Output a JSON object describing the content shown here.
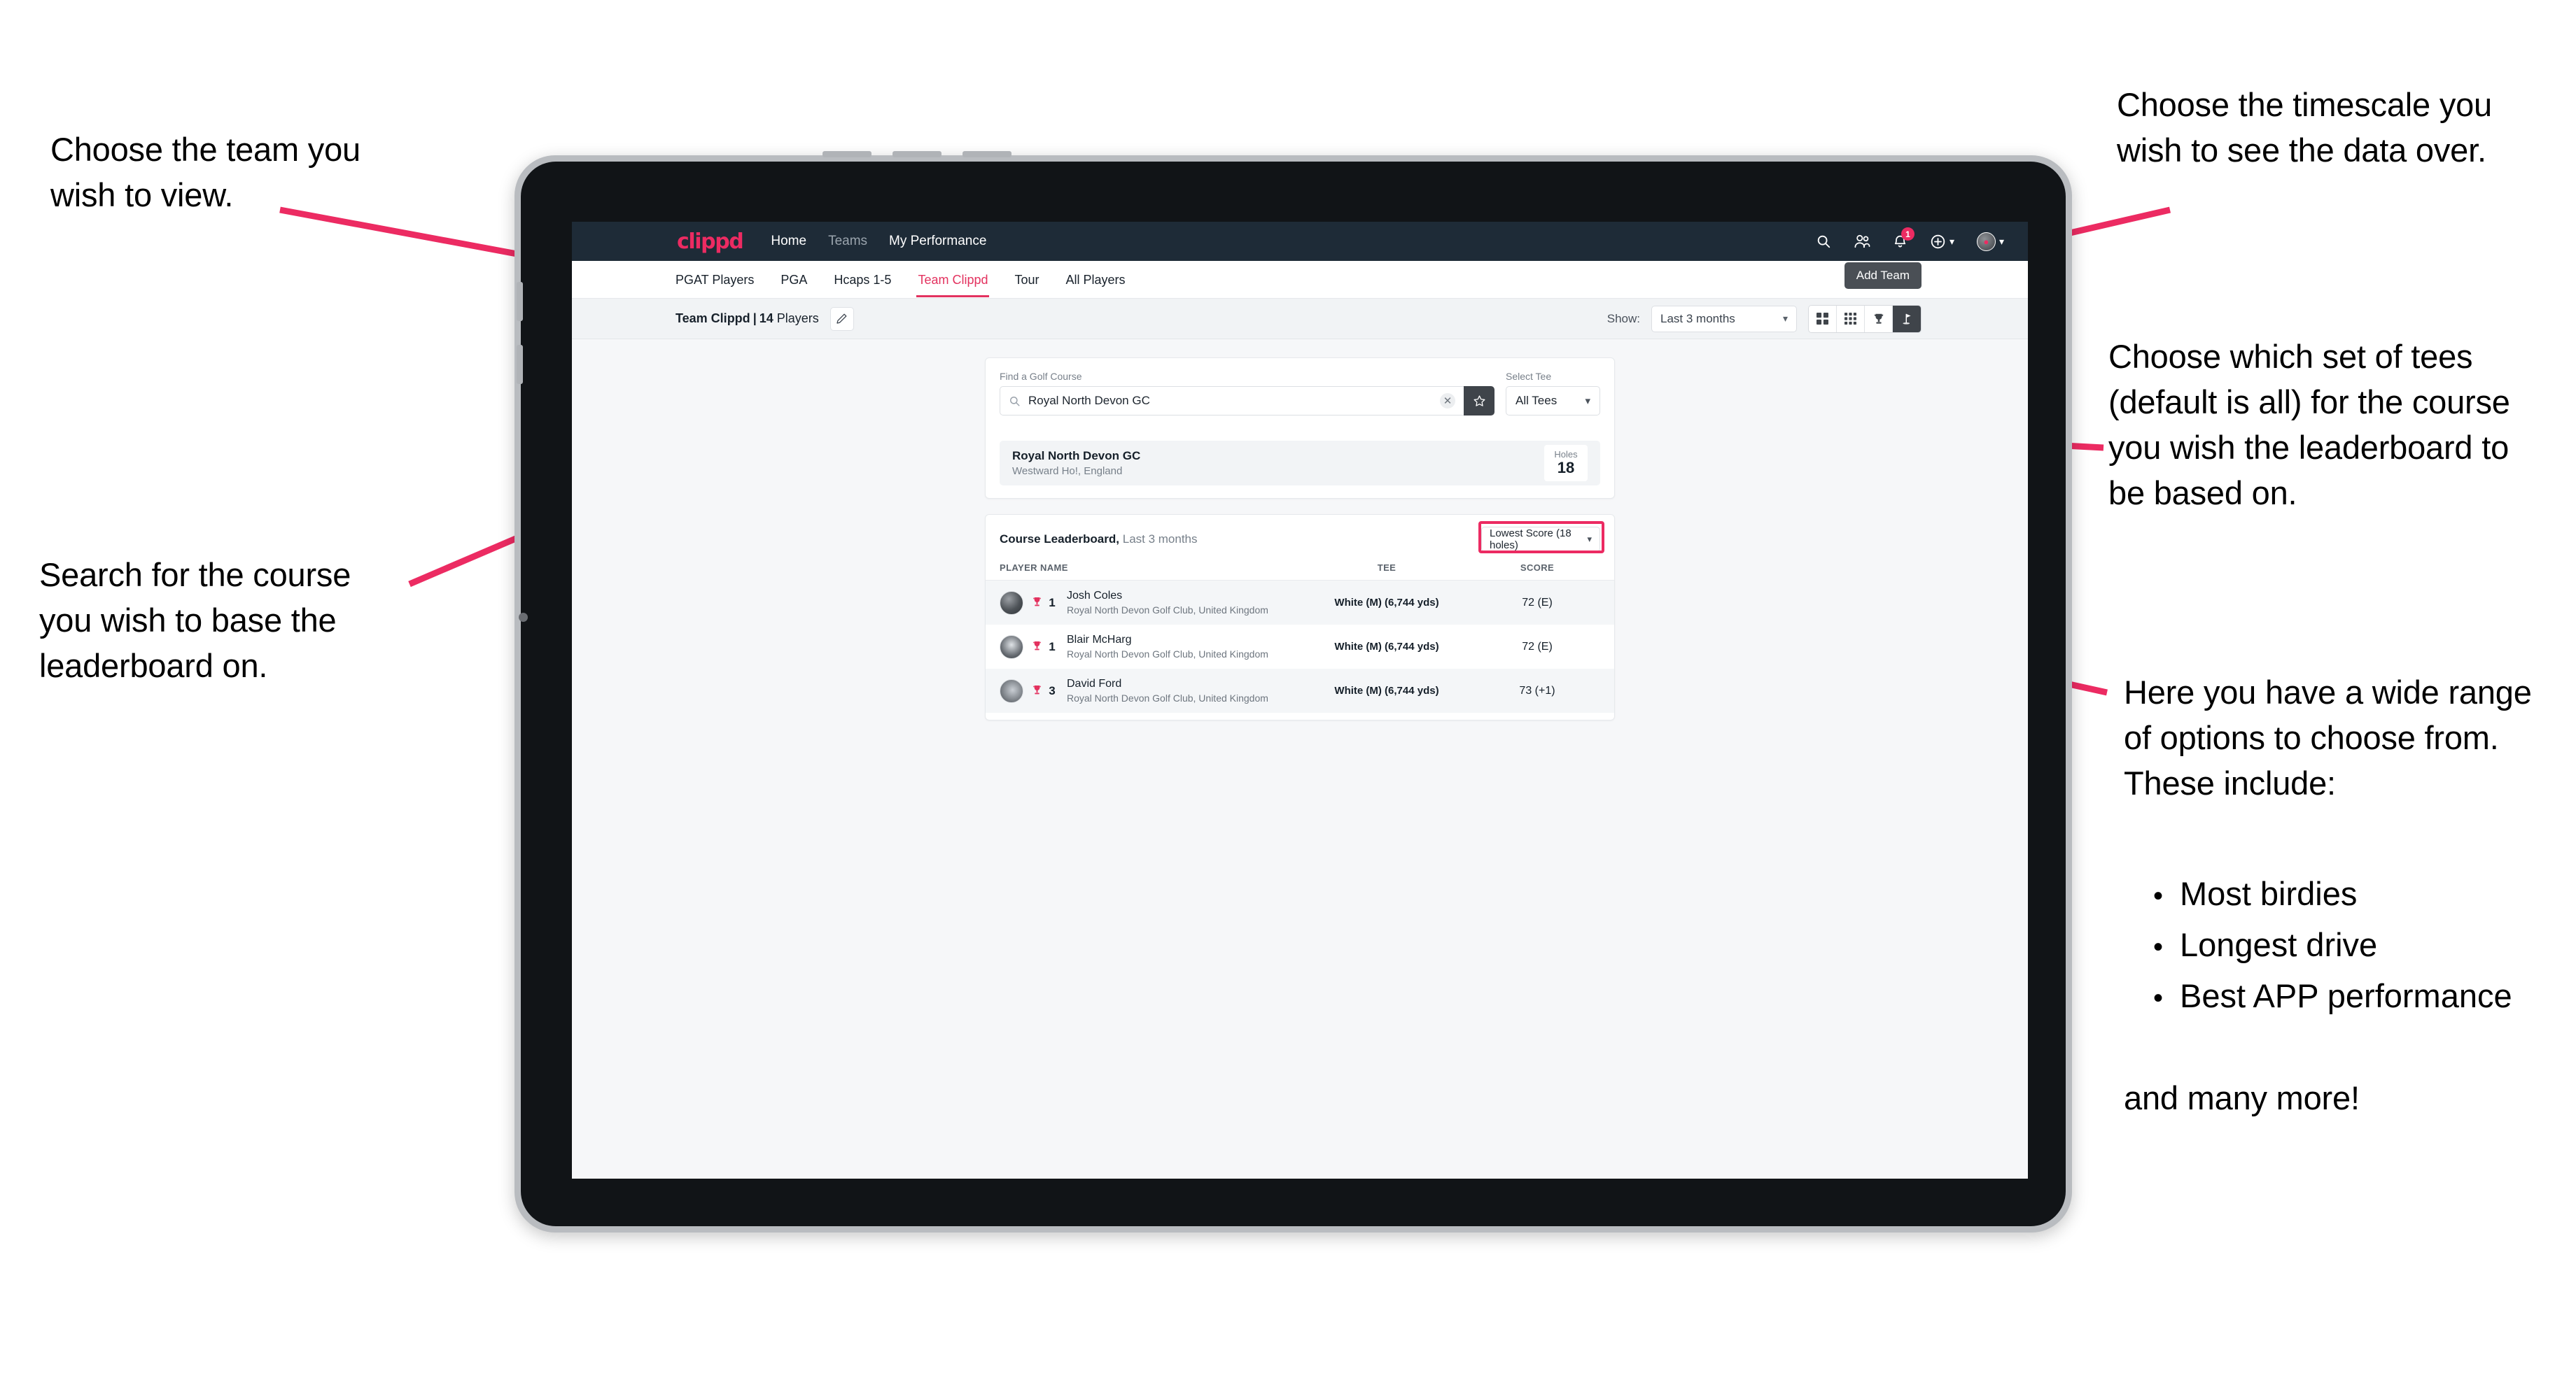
{
  "annotations": {
    "team": "Choose the team you\nwish to view.",
    "course_search": "Search for the course\nyou wish to base the\nleaderboard on.",
    "timescale": "Choose the timescale you\nwish to see the data over.",
    "tees": "Choose which set of tees\n(default is all) for the course\nyou wish the leaderboard to\nbe based on.",
    "options_intro": "Here you have a wide range\nof options to choose from.\nThese include:",
    "options_list": [
      "Most birdies",
      "Longest drive",
      "Best APP performance"
    ],
    "options_outro": "and many more!"
  },
  "app": {
    "brand": "clippd",
    "nav_links": [
      {
        "label": "Home",
        "active": true
      },
      {
        "label": "Teams",
        "active": false
      },
      {
        "label": "My Performance",
        "active": true
      }
    ],
    "icons": {
      "search": "search-icon",
      "people": "people-icon",
      "bell": "notifications-icon",
      "plus": "add-icon",
      "avatar": "user-avatar"
    },
    "notification_count": "1",
    "tooltip": "Add Team",
    "tabs": [
      {
        "label": "PGAT Players",
        "state": "normal"
      },
      {
        "label": "PGA",
        "state": "normal"
      },
      {
        "label": "Hcaps 1-5",
        "state": "normal"
      },
      {
        "label": "Team Clippd",
        "state": "active"
      },
      {
        "label": "Tour",
        "state": "normal"
      },
      {
        "label": "All Players",
        "state": "normal"
      }
    ],
    "toolbar": {
      "team_name": "Team Clippd",
      "separator": "|",
      "player_count": "14",
      "players_word": "Players",
      "edit_icon": "pencil-icon",
      "show_label": "Show:",
      "show_value": "Last 3 months",
      "views": [
        {
          "name": "grid-2x2-view",
          "selected": false
        },
        {
          "name": "grid-3x3-view",
          "selected": false
        },
        {
          "name": "trophy-view",
          "selected": false
        },
        {
          "name": "golf-flag-view",
          "selected": true
        }
      ]
    },
    "search": {
      "label": "Find a Golf Course",
      "value": "Royal North Devon GC",
      "placeholder": "Find a Golf Course",
      "clear_icon": "clear-icon",
      "favorite_icon": "star-icon",
      "tee_label": "Select Tee",
      "tee_value": "All Tees"
    },
    "course": {
      "name": "Royal North Devon GC",
      "location": "Westward Ho!, England",
      "holes_label": "Holes",
      "holes_value": "18"
    },
    "leaderboard": {
      "title": "Course Leaderboard,",
      "subtitle": "Last 3 months",
      "sort_value": "Lowest Score (18 holes)",
      "columns": [
        "PLAYER NAME",
        "TEE",
        "SCORE"
      ],
      "rows": [
        {
          "rank": "1",
          "name": "Josh Coles",
          "club": "Royal North Devon Golf Club, United Kingdom",
          "tee": "White (M) (6,744 yds)",
          "score": "72 (E)"
        },
        {
          "rank": "1",
          "name": "Blair McHarg",
          "club": "Royal North Devon Golf Club, United Kingdom",
          "tee": "White (M) (6,744 yds)",
          "score": "72 (E)"
        },
        {
          "rank": "3",
          "name": "David Ford",
          "club": "Royal North Devon Golf Club, United Kingdom",
          "tee": "White (M) (6,744 yds)",
          "score": "73 (+1)"
        }
      ]
    }
  },
  "colors": {
    "accent_pink": "#ec2b62",
    "nav_dark": "#1e2b37",
    "tab_active": "#e3325f",
    "toggle_on": "#3f444a"
  }
}
